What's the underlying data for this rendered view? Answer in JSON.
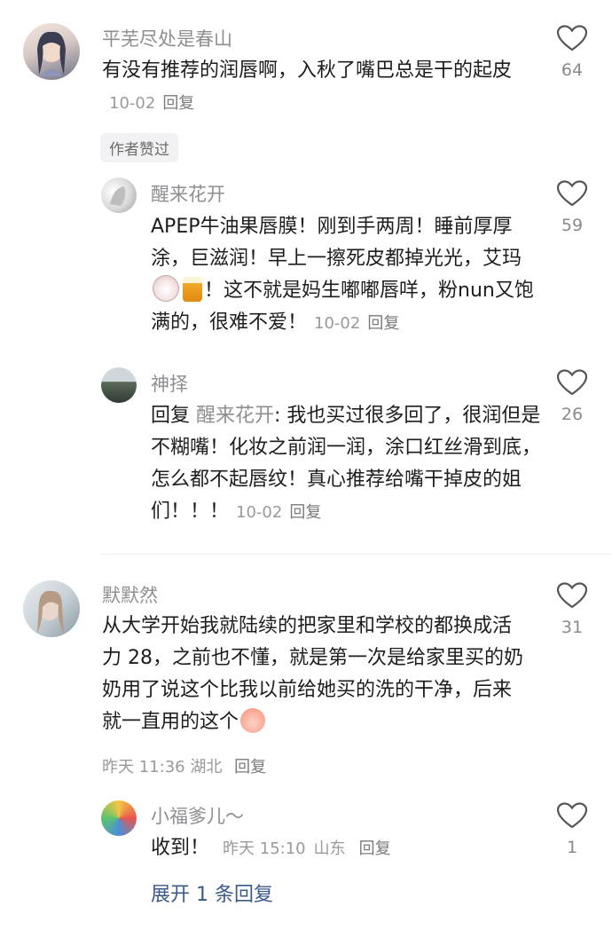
{
  "comments": [
    {
      "user": "平芜尽处是春山",
      "text": "有没有推荐的润唇啊，入秋了嘴巴总是干的起皮",
      "date": "10-02",
      "reply_label": "回复",
      "likes": "64",
      "badge": "作者赞过",
      "replies": [
        {
          "user": "醒来花开",
          "text_a": "APEP牛油果唇膜！刚到手两周！睡前厚厚涂，巨滋润！早上一擦死皮都掉光光，艾玛",
          "text_b": "！这不就是妈生嘟嘟唇咩，粉nun又饱满的，很难不爱！",
          "emoji_1": "cow-face-icon",
          "emoji_2": "beer-mug-icon",
          "date": "10-02",
          "reply_label": "回复",
          "likes": "59"
        },
        {
          "user": "神择",
          "prefix": "回复",
          "mention": "醒来花开",
          "text": ": 我也买过很多回了，很润但是不糊嘴！化妆之前润一润，涂口红丝滑到底，怎么都不起唇纹！真心推荐给嘴干掉皮的姐们！！！",
          "date": "10-02",
          "reply_label": "回复",
          "likes": "26"
        }
      ]
    },
    {
      "user": "默默然",
      "text": "从大学开始我就陆续的把家里和学校的都换成活力 28，之前也不懂，就是第一次是给家里买的奶奶用了说这个比我以前给她买的洗的干净，后来就一直用的这个",
      "emoji": "peach-face-icon",
      "date": "昨天 11:36",
      "location": "湖北",
      "reply_label": "回复",
      "likes": "31",
      "replies": [
        {
          "user": "小福爹儿～",
          "text": "收到！",
          "date": "昨天 15:10",
          "location": "山东",
          "reply_label": "回复",
          "likes": "1"
        }
      ],
      "expand_label": "展开 1 条回复"
    }
  ],
  "colors": {
    "name": "#8e8e93",
    "text": "#1d1d1f",
    "meta": "#9a9a9a",
    "expand": "#3a5a8a"
  }
}
